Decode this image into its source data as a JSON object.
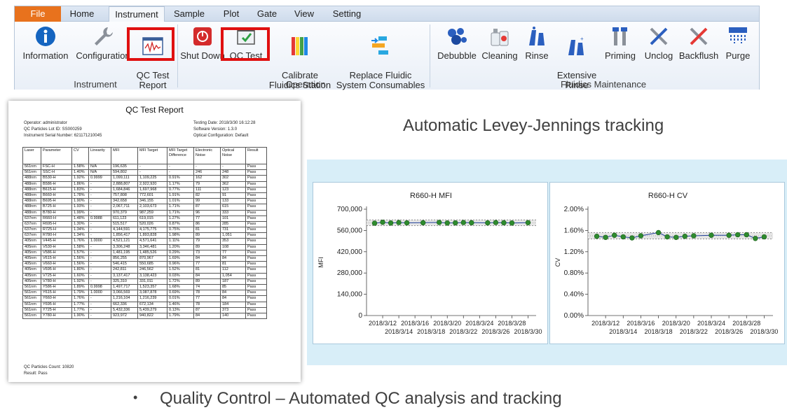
{
  "ribbon": {
    "tabs": [
      "File",
      "Home",
      "Instrument",
      "Sample",
      "Plot",
      "Gate",
      "View",
      "Setting"
    ],
    "groups": {
      "instrument": {
        "label": "Instrument",
        "buttons": [
          "Information",
          "Configuration",
          "QC Test\nReport"
        ]
      },
      "operation": {
        "label": "Operation",
        "buttons": [
          "Shut Down",
          "QC Test",
          "Calibrate\nFluidics Station",
          "Replace Fluidic\nSystem Consumables"
        ]
      },
      "fluidics": {
        "label": "Fluidics Maintenance",
        "buttons": [
          "Debubble",
          "Cleaning",
          "Rinse",
          "Extensive\nRinse",
          "Priming",
          "Unclog",
          "Backflush",
          "Purge"
        ]
      }
    }
  },
  "report": {
    "title": "QC Test Report",
    "operator": "Operator: administrator",
    "lot": "QC Particles Lot ID: SS000259",
    "serial": "Instrument Serial Number: 621171210045",
    "date": "Testing Date: 2018/3/30 16:12:28",
    "software": "Software Version: 1.3.0",
    "optical": "Optical Configuration: Default",
    "headers": [
      "Laser",
      "Parameter",
      "CV",
      "Linearity",
      "MFI",
      "MFI Target",
      "MFI Target\nDifference",
      "Electronic\nNoise",
      "Optical\nNoise",
      "Result"
    ],
    "rows": [
      [
        "561nm",
        "FSC-H",
        "1.58%",
        "N/A",
        "196,635",
        "-",
        "-",
        "-",
        "-",
        "Pass"
      ],
      [
        "561nm",
        "SSC-H",
        "1.40%",
        "N/A",
        "594,802",
        "-",
        "-",
        "246",
        "248",
        "Pass"
      ],
      [
        "488nm",
        "B530-H",
        "1.92%",
        "0.9999",
        "1,099,111",
        "1,109,225",
        "0.91%",
        "162",
        "302",
        "Pass"
      ],
      [
        "488nm",
        "B586-H",
        "1.86%",
        "-",
        "2,888,807",
        "2,922,920",
        "1.17%",
        "79",
        "362",
        "Pass"
      ],
      [
        "488nm",
        "B615-H",
        "1.83%",
        "-",
        "1,684,846",
        "1,697,968",
        "0.77%",
        "111",
        "123",
        "Pass"
      ],
      [
        "488nm",
        "B660-H",
        "1.78%",
        "-",
        "757,808",
        "772,601",
        "1.91%",
        "82",
        "91",
        "Pass"
      ],
      [
        "488nm",
        "B695-H",
        "1.90%",
        "-",
        "342,658",
        "346,155",
        "1.01%",
        "99",
        "133",
        "Pass"
      ],
      [
        "488nm",
        "B725-H",
        "1.93%",
        "-",
        "2,067,711",
        "2,103,673",
        "1.71%",
        "87",
        "615",
        "Pass"
      ],
      [
        "488nm",
        "B780-H",
        "1.99%",
        "-",
        "970,379",
        "987,259",
        "1.71%",
        "96",
        "333",
        "Pass"
      ],
      [
        "637nm",
        "R660-H",
        "1.48%",
        "0.9988",
        "611,123",
        "619,015",
        "1.27%",
        "77",
        "101",
        "Pass"
      ],
      [
        "637nm",
        "R695-H",
        "1.30%",
        "-",
        "515,517",
        "520,026",
        "0.87%",
        "86",
        "285",
        "Pass"
      ],
      [
        "637nm",
        "R725-H",
        "1.34%",
        "-",
        "4,144,591",
        "4,175,775",
        "0.75%",
        "81",
        "731",
        "Pass"
      ],
      [
        "637nm",
        "R780-H",
        "1.34%",
        "-",
        "1,856,417",
        "1,893,828",
        "1.98%",
        "89",
        "1,051",
        "Pass"
      ],
      [
        "405nm",
        "V445-H",
        "1.76%",
        "1.0000",
        "4,521,121",
        "4,571,641",
        "1.11%",
        "79",
        "353",
        "Pass"
      ],
      [
        "405nm",
        "V530-H",
        "1.58%",
        "-",
        "3,306,248",
        "3,346,481",
        "1.20%",
        "89",
        "108",
        "Pass"
      ],
      [
        "405nm",
        "V586-H",
        "1.57%",
        "-",
        "1,481,195",
        "1,485,526",
        "0.29%",
        "73",
        "77",
        "Pass"
      ],
      [
        "405nm",
        "V615-H",
        "1.56%",
        "-",
        "856,255",
        "870,967",
        "1.69%",
        "84",
        "84",
        "Pass"
      ],
      [
        "405nm",
        "V660-H",
        "1.56%",
        "-",
        "546,415",
        "550,685",
        "0.96%",
        "77",
        "81",
        "Pass"
      ],
      [
        "405nm",
        "V695-H",
        "1.80%",
        "-",
        "242,811",
        "246,562",
        "1.52%",
        "81",
        "112",
        "Pass"
      ],
      [
        "405nm",
        "V725-H",
        "1.60%",
        "-",
        "3,137,417",
        "3,138,423",
        "0.03%",
        "84",
        "1,054",
        "Pass"
      ],
      [
        "405nm",
        "V780-H",
        "1.92%",
        "-",
        "325,310",
        "331,011",
        "1.72%",
        "89",
        "187",
        "Pass"
      ],
      [
        "561nm",
        "Y586-H",
        "1.89%",
        "0.9998",
        "1,497,717",
        "1,523,357",
        "1.68%",
        "74",
        "85",
        "Pass"
      ],
      [
        "561nm",
        "Y615-H",
        "1.79%",
        "1.0000",
        "3,066,569",
        "3,087,878",
        "0.69%",
        "78",
        "84",
        "Pass"
      ],
      [
        "561nm",
        "Y660-H",
        "1.76%",
        "-",
        "1,216,104",
        "1,216,239",
        "0.01%",
        "77",
        "84",
        "Pass"
      ],
      [
        "561nm",
        "Y695-H",
        "1.77%",
        "-",
        "662,336",
        "672,134",
        "1.46%",
        "78",
        "184",
        "Pass"
      ],
      [
        "561nm",
        "Y725-H",
        "1.77%",
        "-",
        "5,432,336",
        "5,439,279",
        "0.13%",
        "87",
        "373",
        "Pass"
      ],
      [
        "561nm",
        "Y780-H",
        "1.90%",
        "-",
        "923,972",
        "940,822",
        "1.79%",
        "84",
        "140",
        "Pass"
      ]
    ],
    "count": "QC Particles Count: 10820",
    "result": "Result: Pass"
  },
  "lj_title": "Automatic Levey-Jennings tracking",
  "bullet": "Quality Control – Automated QC analysis and tracking",
  "colors": {
    "file_tab": "#e8721d",
    "highlight": "#e01010",
    "point": "#2e8b2e",
    "line": "#1f3f99",
    "panel": "#d8eef8"
  },
  "chart_data": [
    {
      "type": "line",
      "title": "R660-H MFI",
      "ylabel": "MFI",
      "xlabel": "",
      "ylim": [
        0,
        700000
      ],
      "yticks": [
        "0",
        "140,000",
        "280,000",
        "420,000",
        "560,000",
        "700,000"
      ],
      "xticks_top": [
        "2018/3/12",
        "2018/3/16",
        "2018/3/20",
        "2018/3/24",
        "2018/3/28"
      ],
      "xticks_bottom": [
        "2018/3/14",
        "2018/3/18",
        "2018/3/22",
        "2018/3/26",
        "2018/3/30"
      ],
      "xlim": [
        "2018/3/10",
        "2018/3/31"
      ],
      "x": [
        "2018/3/11",
        "2018/3/12",
        "2018/3/13",
        "2018/3/14",
        "2018/3/15",
        "2018/3/17",
        "2018/3/19",
        "2018/3/20",
        "2018/3/21",
        "2018/3/22",
        "2018/3/23",
        "2018/3/25",
        "2018/3/26",
        "2018/3/27",
        "2018/3/28",
        "2018/3/30"
      ],
      "series": [
        {
          "values": [
            608000,
            614000,
            609000,
            612000,
            610000,
            611000,
            613000,
            609000,
            610000,
            612000,
            611000,
            610000,
            612000,
            611000,
            609000,
            611123
          ]
        }
      ],
      "band": [
        592000,
        630000
      ]
    },
    {
      "type": "line",
      "title": "R660-H CV",
      "ylabel": "CV",
      "xlabel": "",
      "ylim": [
        0,
        2.0
      ],
      "yticks": [
        "0.00%",
        "0.40%",
        "0.80%",
        "1.20%",
        "1.60%",
        "2.00%"
      ],
      "xticks_top": [
        "2018/3/12",
        "2018/3/16",
        "2018/3/20",
        "2018/3/24",
        "2018/3/28"
      ],
      "xticks_bottom": [
        "2018/3/14",
        "2018/3/18",
        "2018/3/22",
        "2018/3/26",
        "2018/3/30"
      ],
      "xlim": [
        "2018/3/10",
        "2018/3/31"
      ],
      "x": [
        "2018/3/11",
        "2018/3/12",
        "2018/3/13",
        "2018/3/14",
        "2018/3/15",
        "2018/3/16",
        "2018/3/18",
        "2018/3/19",
        "2018/3/20",
        "2018/3/21",
        "2018/3/22",
        "2018/3/24",
        "2018/3/26",
        "2018/3/27",
        "2018/3/28",
        "2018/3/29",
        "2018/3/30"
      ],
      "series": [
        {
          "values": [
            1.49,
            1.47,
            1.51,
            1.48,
            1.46,
            1.5,
            1.56,
            1.48,
            1.47,
            1.49,
            1.5,
            1.51,
            1.51,
            1.52,
            1.52,
            1.45,
            1.48
          ]
        }
      ],
      "band": [
        1.44,
        1.56
      ]
    }
  ]
}
